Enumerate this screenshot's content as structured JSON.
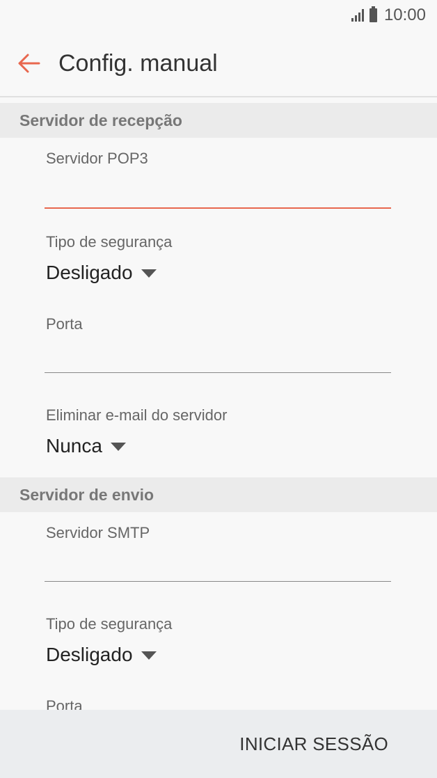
{
  "status_bar": {
    "time": "10:00"
  },
  "header": {
    "title": "Config. manual",
    "back_icon": "arrow-left-icon"
  },
  "incoming": {
    "section_title": "Servidor de recepção",
    "server_label": "Servidor POP3",
    "server_value": "",
    "security_label": "Tipo de segurança",
    "security_value": "Desligado",
    "port_label": "Porta",
    "port_value": "",
    "delete_label": "Eliminar e-mail do servidor",
    "delete_value": "Nunca"
  },
  "outgoing": {
    "section_title": "Servidor de envio",
    "server_label": "Servidor SMTP",
    "server_value": "",
    "security_label": "Tipo de segurança",
    "security_value": "Desligado",
    "port_label": "Porta"
  },
  "footer": {
    "login_label": "INICIAR SESSÃO"
  },
  "colors": {
    "accent": "#e8674e",
    "background": "#f8f8f8",
    "section_bg": "#ebebeb"
  }
}
